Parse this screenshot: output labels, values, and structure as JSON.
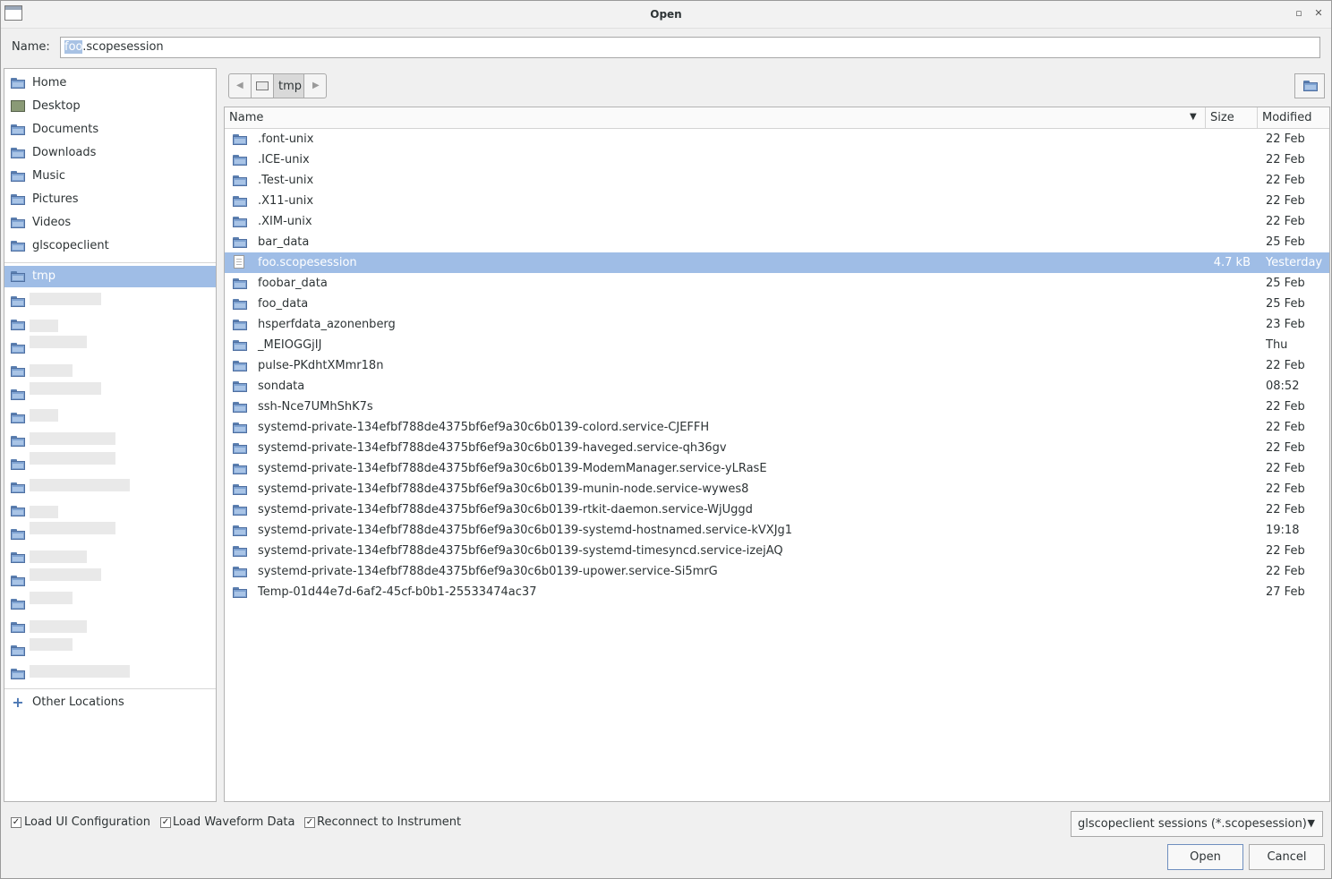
{
  "window": {
    "title": "Open"
  },
  "name_field": {
    "label": "Name:",
    "selected_part": "foo",
    "rest": ".scopesession"
  },
  "sidebar": {
    "places": [
      {
        "label": "Home",
        "icon": "home-folder-icon"
      },
      {
        "label": "Desktop",
        "icon": "desktop-icon"
      },
      {
        "label": "Documents",
        "icon": "folder-icon"
      },
      {
        "label": "Downloads",
        "icon": "folder-icon"
      },
      {
        "label": "Music",
        "icon": "folder-icon"
      },
      {
        "label": "Pictures",
        "icon": "folder-icon"
      },
      {
        "label": "Videos",
        "icon": "folder-icon"
      },
      {
        "label": "glscopeclient",
        "icon": "folder-icon"
      }
    ],
    "current": "tmp",
    "other_locations": "Other Locations"
  },
  "pathbar": {
    "current": "tmp"
  },
  "columns": {
    "name": "Name",
    "size": "Size",
    "modified": "Modified"
  },
  "files": [
    {
      "name": ".font-unix",
      "size": "",
      "modified": "22 Feb"
    },
    {
      "name": ".ICE-unix",
      "size": "",
      "modified": "22 Feb"
    },
    {
      "name": ".Test-unix",
      "size": "",
      "modified": "22 Feb"
    },
    {
      "name": ".X11-unix",
      "size": "",
      "modified": "22 Feb"
    },
    {
      "name": ".XIM-unix",
      "size": "",
      "modified": "22 Feb"
    },
    {
      "name": "bar_data",
      "size": "",
      "modified": "25 Feb"
    },
    {
      "name": "foo.scopesession",
      "size": "4.7 kB",
      "modified": "Yesterday"
    },
    {
      "name": "foobar_data",
      "size": "",
      "modified": "25 Feb"
    },
    {
      "name": "foo_data",
      "size": "",
      "modified": "25 Feb"
    },
    {
      "name": "hsperfdata_azonenberg",
      "size": "",
      "modified": "23 Feb"
    },
    {
      "name": "_MEIOGGjIJ",
      "size": "",
      "modified": "Thu"
    },
    {
      "name": "pulse-PKdhtXMmr18n",
      "size": "",
      "modified": "22 Feb"
    },
    {
      "name": "sondata",
      "size": "",
      "modified": "08:52"
    },
    {
      "name": "ssh-Nce7UMhShK7s",
      "size": "",
      "modified": "22 Feb"
    },
    {
      "name": "systemd-private-134efbf788de4375bf6ef9a30c6b0139-colord.service-CJEFFH",
      "size": "",
      "modified": "22 Feb"
    },
    {
      "name": "systemd-private-134efbf788de4375bf6ef9a30c6b0139-haveged.service-qh36gv",
      "size": "",
      "modified": "22 Feb"
    },
    {
      "name": "systemd-private-134efbf788de4375bf6ef9a30c6b0139-ModemManager.service-yLRasE",
      "size": "",
      "modified": "22 Feb"
    },
    {
      "name": "systemd-private-134efbf788de4375bf6ef9a30c6b0139-munin-node.service-wywes8",
      "size": "",
      "modified": "22 Feb"
    },
    {
      "name": "systemd-private-134efbf788de4375bf6ef9a30c6b0139-rtkit-daemon.service-WjUggd",
      "size": "",
      "modified": "22 Feb"
    },
    {
      "name": "systemd-private-134efbf788de4375bf6ef9a30c6b0139-systemd-hostnamed.service-kVXJg1",
      "size": "",
      "modified": "19:18"
    },
    {
      "name": "systemd-private-134efbf788de4375bf6ef9a30c6b0139-systemd-timesyncd.service-izejAQ",
      "size": "",
      "modified": "22 Feb"
    },
    {
      "name": "systemd-private-134efbf788de4375bf6ef9a30c6b0139-upower.service-Si5mrG",
      "size": "",
      "modified": "22 Feb"
    },
    {
      "name": "Temp-01d44e7d-6af2-45cf-b0b1-25533474ac37",
      "size": "",
      "modified": "27 Feb"
    }
  ],
  "selected_file": "foo.scopesession",
  "options": [
    {
      "label": "Load UI Configuration",
      "checked": true
    },
    {
      "label": "Load Waveform Data",
      "checked": true
    },
    {
      "label": "Reconnect to Instrument",
      "checked": true
    }
  ],
  "filter": {
    "label": "glscopeclient sessions (*.scopesession)"
  },
  "buttons": {
    "open": "Open",
    "cancel": "Cancel"
  },
  "colors": {
    "selection": "#9fbde6",
    "folder": "#7fa3d2",
    "accent": "#4a76b3"
  }
}
